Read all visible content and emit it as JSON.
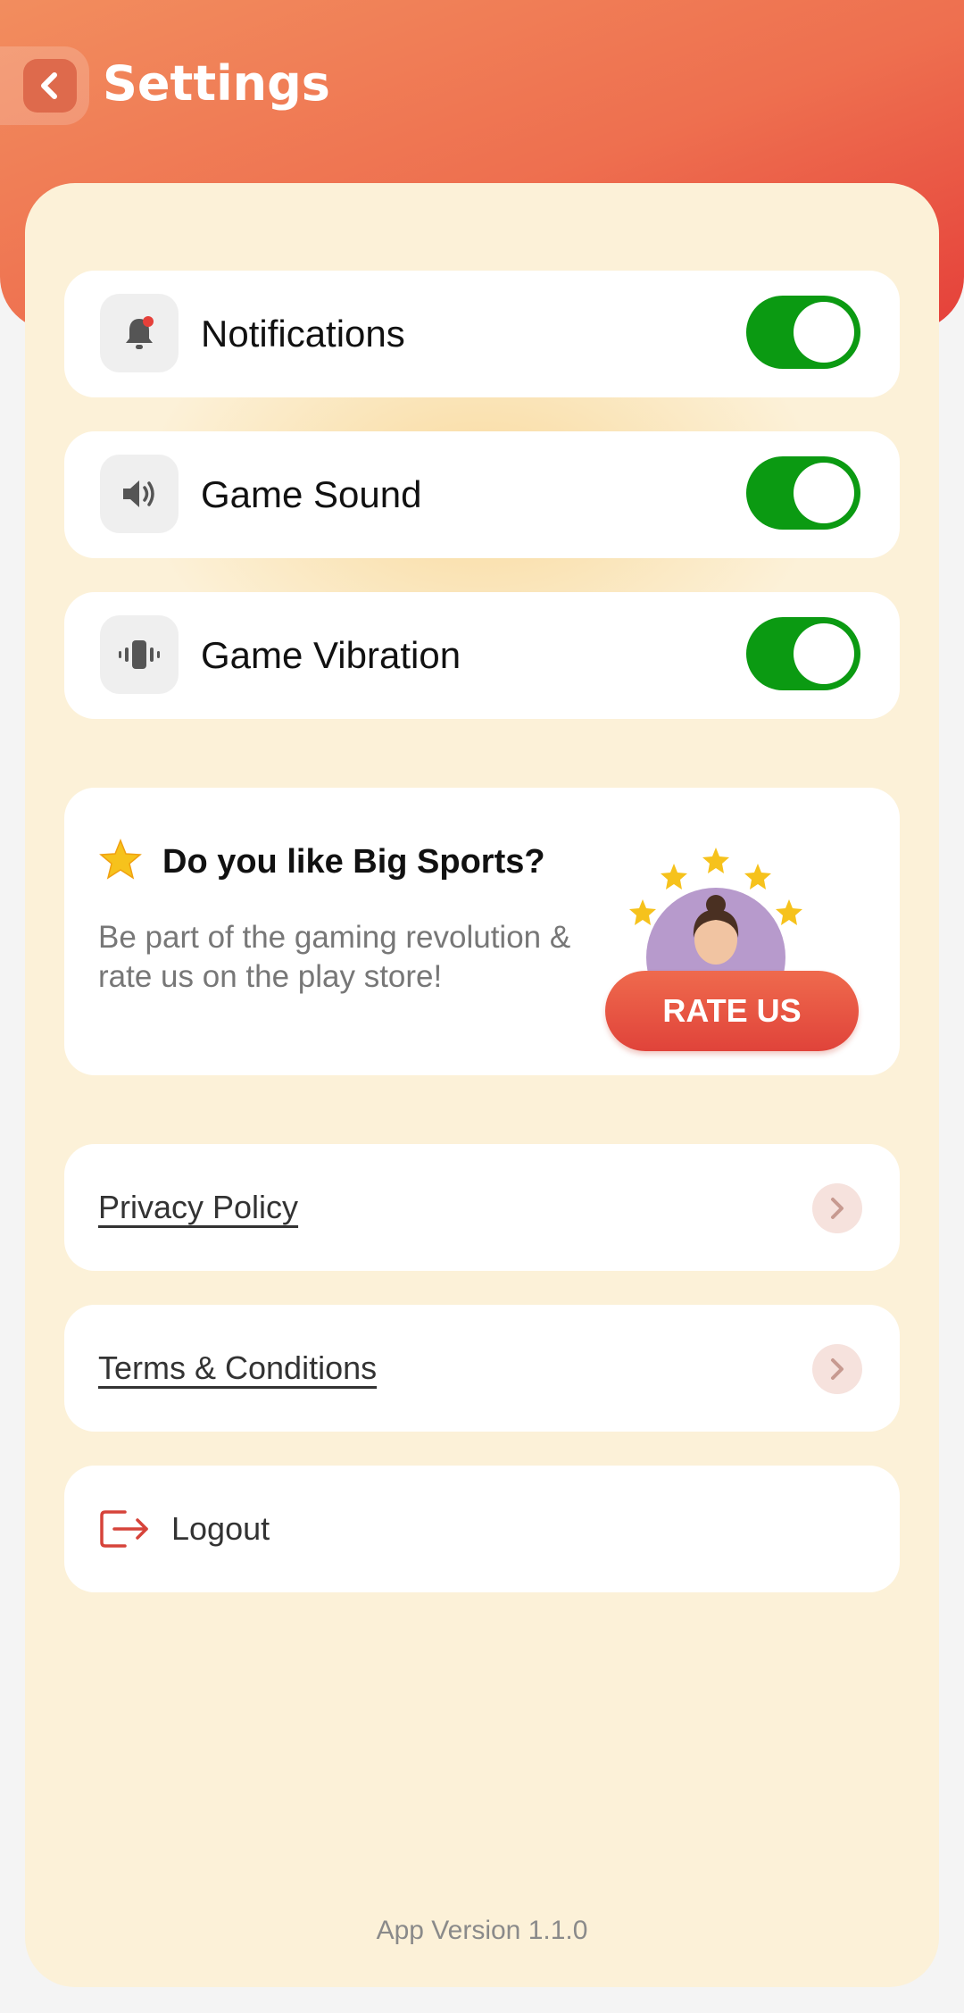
{
  "header": {
    "title": "Settings",
    "back_icon": "chevron-left-icon"
  },
  "settings": [
    {
      "label": "Notifications",
      "icon": "bell-icon",
      "enabled": true
    },
    {
      "label": "Game Sound",
      "icon": "speaker-icon",
      "enabled": true
    },
    {
      "label": "Game Vibration",
      "icon": "vibration-icon",
      "enabled": true
    }
  ],
  "rate": {
    "title": "Do you like Big Sports?",
    "description": "Be part of the gaming revolution & rate us on the play store!",
    "button_label": "RATE US"
  },
  "links": [
    {
      "label": "Privacy Policy"
    },
    {
      "label": "Terms & Conditions"
    }
  ],
  "logout": {
    "label": "Logout"
  },
  "footer": {
    "app_version": "App Version 1.1.0"
  },
  "colors": {
    "header_start": "#f28d5e",
    "header_end": "#e5403a",
    "toggle_on": "#0b9a12",
    "panel_bg": "#fcf1d8",
    "accent": "#e0433a"
  }
}
